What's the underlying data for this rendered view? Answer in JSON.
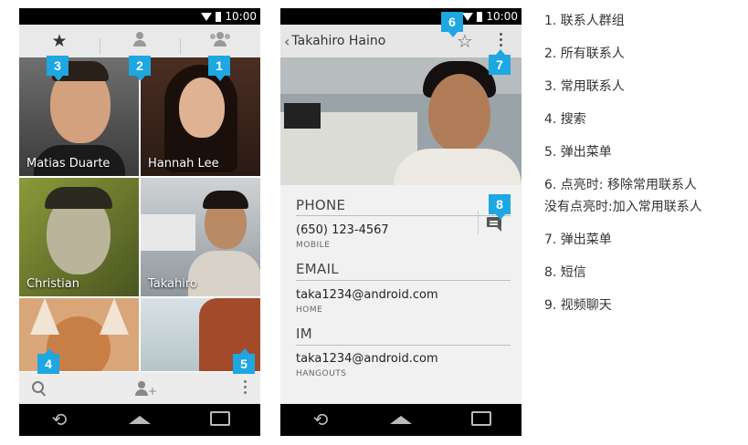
{
  "status_bar": {
    "time": "10:00"
  },
  "left_phone": {
    "tabs": [
      {
        "icon": "star-icon",
        "glyph": "★"
      },
      {
        "icon": "person-icon",
        "glyph": "●"
      },
      {
        "icon": "group-icon",
        "glyph": "●●"
      }
    ],
    "tiles": [
      {
        "name": "Matias Duarte"
      },
      {
        "name": "Hannah Lee"
      },
      {
        "name": "Christian"
      },
      {
        "name": "Takahiro"
      }
    ],
    "bottom_bar": {
      "search_glyph": "🔍",
      "add_glyph": "+",
      "menu_glyph": "⋮"
    }
  },
  "right_phone": {
    "title": "Takahiro Haino",
    "back_glyph": "‹",
    "star_glyph": "☆",
    "sections": {
      "phone": {
        "header": "PHONE",
        "value": "(650) 123-4567",
        "sub": "MOBILE"
      },
      "email": {
        "header": "EMAIL",
        "value": "taka1234@android.com",
        "sub": "HOME"
      },
      "im": {
        "header": "IM",
        "value": "taka1234@android.com",
        "sub": "HANGOUTS"
      }
    }
  },
  "nav": {
    "back_glyph": "⟲"
  },
  "badges": [
    "1",
    "2",
    "3",
    "4",
    "5",
    "6",
    "7",
    "8"
  ],
  "legend": [
    "1. 联系人群组",
    "2. 所有联系人",
    "3. 常用联系人",
    "4. 搜索",
    "5. 弹出菜单",
    "6. 点亮时: 移除常用联系人",
    "没有点亮时:加入常用联系人",
    "7. 弹出菜单",
    "8. 短信",
    "9. 视频聊天"
  ],
  "colors": {
    "badge": "#1ea7e1",
    "bar": "#e9e9e9"
  }
}
